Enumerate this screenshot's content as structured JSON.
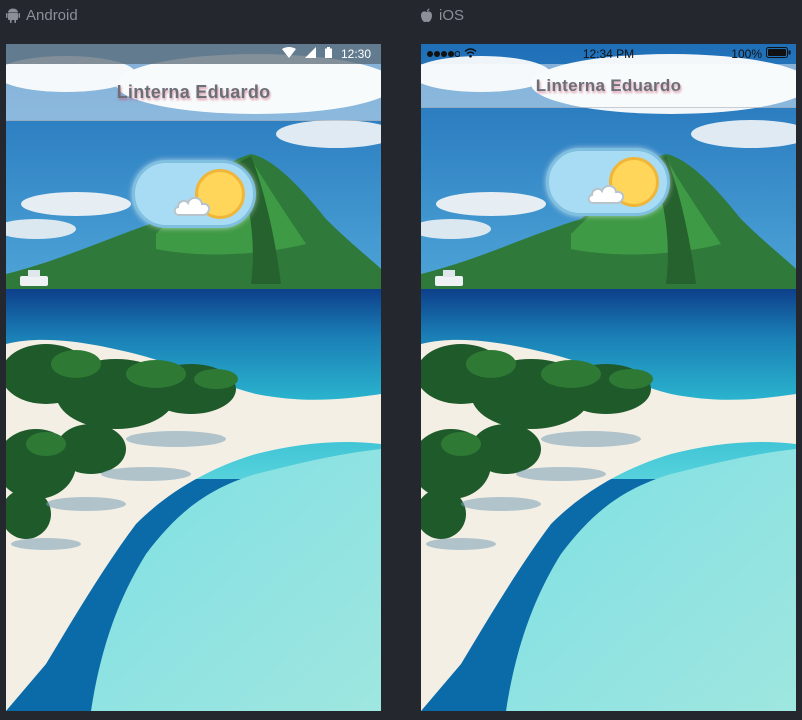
{
  "platforms": {
    "android": {
      "label": "Android"
    },
    "ios": {
      "label": "iOS"
    }
  },
  "android_screen": {
    "status_time": "12:30",
    "app_title": "Linterna Eduardo"
  },
  "ios_screen": {
    "status_time": "12:34 PM",
    "battery": "100%",
    "app_title": "Linterna Eduardo"
  },
  "colors": {
    "background": "#24272d",
    "toggle_track": "#a8dcf4",
    "sun": "#ffd659"
  },
  "icons": [
    "android-icon",
    "apple-icon",
    "wifi-icon",
    "signal-icon",
    "battery-icon",
    "sun-icon",
    "cloud-icon"
  ]
}
